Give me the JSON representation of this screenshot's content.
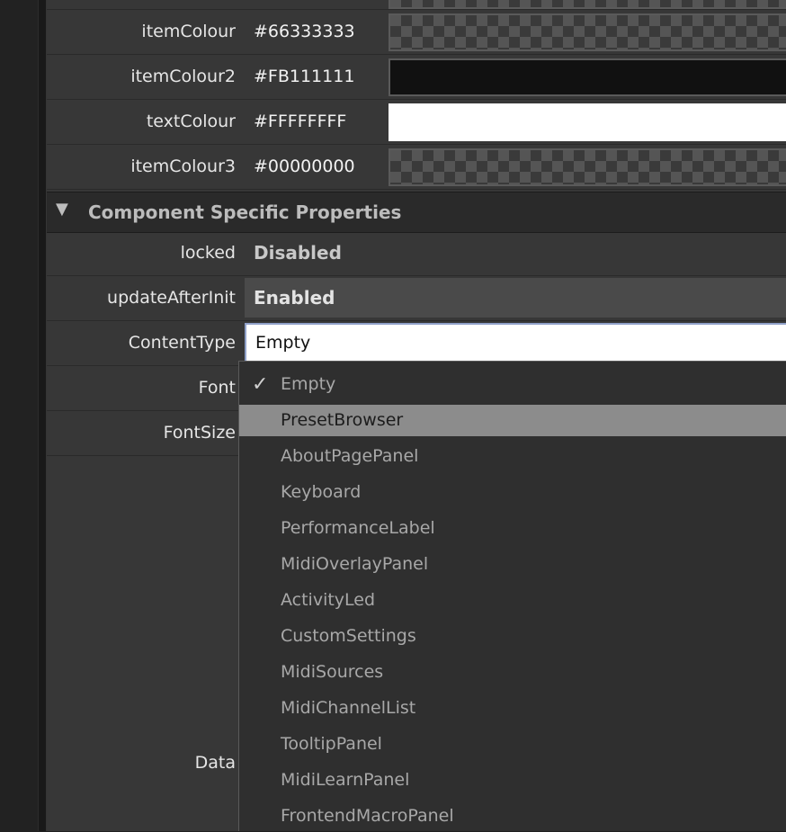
{
  "colour_rows": [
    {
      "label": "itemColour",
      "value": "#66333333",
      "swatch": "checker"
    },
    {
      "label": "itemColour2",
      "value": "#FB111111",
      "swatch": "#111111"
    },
    {
      "label": "textColour",
      "value": "#FFFFFFFF",
      "swatch": "#FFFFFF"
    },
    {
      "label": "itemColour3",
      "value": "#00000000",
      "swatch": "checker"
    }
  ],
  "section": {
    "title": "Component Specific Properties",
    "expanded_icon": "triangle-down-icon"
  },
  "properties": {
    "locked": {
      "label": "locked",
      "value": "Disabled"
    },
    "updateAfterInit": {
      "label": "updateAfterInit",
      "value": "Enabled"
    },
    "contentType": {
      "label": "ContentType",
      "value": "Empty"
    },
    "font": {
      "label": "Font"
    },
    "fontSize": {
      "label": "FontSize"
    },
    "data": {
      "label": "Data"
    }
  },
  "dropdown": {
    "check_glyph": "✓",
    "selected": "Empty",
    "highlighted": "PresetBrowser",
    "items": [
      "Empty",
      "PresetBrowser",
      "AboutPagePanel",
      "Keyboard",
      "PerformanceLabel",
      "MidiOverlayPanel",
      "ActivityLed",
      "CustomSettings",
      "MidiSources",
      "MidiChannelList",
      "TooltipPanel",
      "MidiLearnPanel",
      "FrontendMacroPanel"
    ]
  }
}
